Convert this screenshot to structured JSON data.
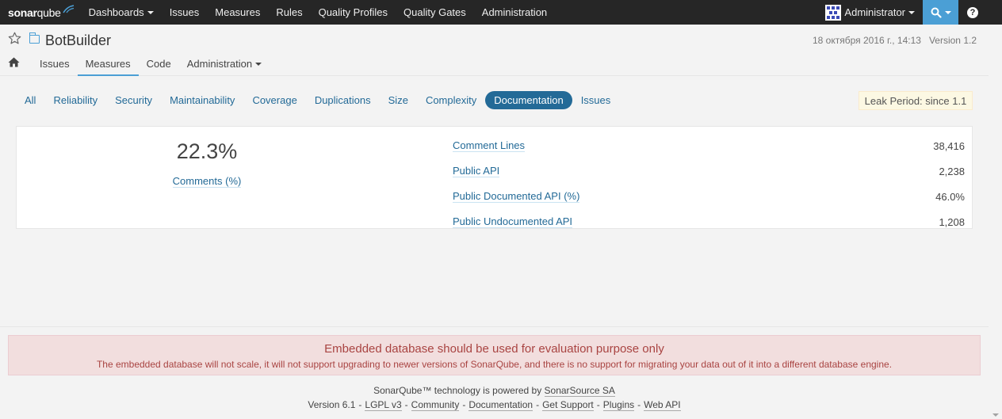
{
  "topnav": {
    "logo_sonar": "sonar",
    "logo_qube": "qube",
    "items": [
      {
        "label": "Dashboards",
        "dropdown": true
      },
      {
        "label": "Issues"
      },
      {
        "label": "Measures"
      },
      {
        "label": "Rules"
      },
      {
        "label": "Quality Profiles"
      },
      {
        "label": "Quality Gates"
      },
      {
        "label": "Administration"
      }
    ],
    "user": "Administrator",
    "help": "?"
  },
  "context": {
    "project_name": "BotBuilder",
    "date": "18 октября 2016 г., 14:13",
    "version": "Version 1.2",
    "tabs": [
      {
        "label": "Issues"
      },
      {
        "label": "Measures",
        "active": true
      },
      {
        "label": "Code"
      },
      {
        "label": "Administration",
        "dropdown": true
      }
    ]
  },
  "domains": {
    "tabs": [
      "All",
      "Reliability",
      "Security",
      "Maintainability",
      "Coverage",
      "Duplications",
      "Size",
      "Complexity",
      "Documentation",
      "Issues"
    ],
    "active": "Documentation",
    "leak_period": "Leak Period: since 1.1"
  },
  "main": {
    "value": "22.3%",
    "label": "Comments (%)",
    "metrics": [
      {
        "name": "Comment Lines",
        "value": "38,416"
      },
      {
        "name": "Public API",
        "value": "2,238"
      },
      {
        "name": "Public Documented API (%)",
        "value": "46.0%"
      },
      {
        "name": "Public Undocumented API",
        "value": "1,208"
      }
    ]
  },
  "warning": {
    "title": "Embedded database should be used for evaluation purpose only",
    "text": "The embedded database will not scale, it will not support upgrading to newer versions of SonarQube, and there is no support for migrating your data out of it into a different database engine."
  },
  "footer": {
    "powered_prefix": "SonarQube™ technology is powered by ",
    "powered_link": "SonarSource SA",
    "version": "Version 6.1",
    "links": [
      "LGPL v3",
      "Community",
      "Documentation",
      "Get Support",
      "Plugins",
      "Web API"
    ],
    "separator": "-"
  },
  "colors": {
    "nav_bg": "#262626",
    "accent": "#4b9fd5",
    "link": "#236a97",
    "warning_bg": "#f2dede",
    "warning_text": "#a94442",
    "leak_bg": "#fcf8e3"
  }
}
